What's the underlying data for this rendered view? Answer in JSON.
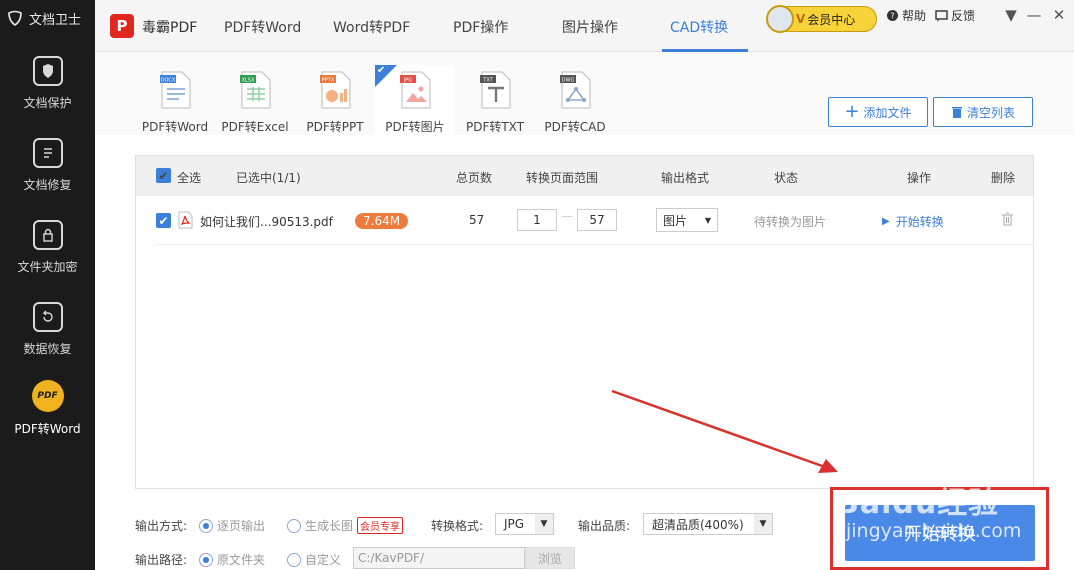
{
  "sidebar": {
    "brand": "文档卫士",
    "items": [
      {
        "label": "文档保护"
      },
      {
        "label": "文档修复"
      },
      {
        "label": "文件夹加密"
      },
      {
        "label": "数据恢复"
      },
      {
        "label": "PDF转Word",
        "icon_text": "PDF"
      }
    ]
  },
  "topbar": {
    "app_logo": "P",
    "app_name": "毒霸PDF",
    "tabs": [
      "PDF转Word",
      "Word转PDF",
      "PDF操作",
      "图片操作",
      "CAD转换"
    ],
    "active_tab": "CAD转换",
    "vip_v": "V",
    "vip_label": "会员中心",
    "help": "帮助",
    "feedback": "反馈"
  },
  "format_tabs": [
    {
      "label": "PDF转Word",
      "badge": "DOCX",
      "color": "#3b7fd9"
    },
    {
      "label": "PDF转Excel",
      "badge": "XLSX",
      "color": "#2e9e4f"
    },
    {
      "label": "PDF转PPT",
      "badge": "PPTX",
      "color": "#e8793a"
    },
    {
      "label": "PDF转图片",
      "badge": "JPG",
      "color": "#e0504a"
    },
    {
      "label": "PDF转TXT",
      "badge": "TXT",
      "color": "#555555"
    },
    {
      "label": "PDF转CAD",
      "badge": "DWG",
      "color": "#555555"
    }
  ],
  "actions": {
    "add_file": "添加文件",
    "clear_list": "清空列表"
  },
  "list": {
    "headers": {
      "select_all": "全选",
      "selected": "已选中(1/1)",
      "total_pages": "总页数",
      "range": "转换页面范围",
      "output_format": "输出格式",
      "status": "状态",
      "operation": "操作",
      "delete": "删除"
    },
    "rows": [
      {
        "filename": "如何让我们...90513.pdf",
        "size": "7.64M",
        "pages": "57",
        "range_from": "1",
        "range_to": "57",
        "format": "图片",
        "status": "待转换为图片",
        "action": "开始转换"
      }
    ]
  },
  "settings": {
    "output_mode_label": "输出方式:",
    "mode_each": "逐页输出",
    "mode_long": "生成长图",
    "vip_tag": "会员专享",
    "convert_format_label": "转换格式:",
    "convert_format": "JPG",
    "quality_label": "输出品质:",
    "quality": "超清品质(400%)",
    "path_label": "输出路径:",
    "path_source": "原文件夹",
    "path_custom": "自定义",
    "path_value": "C:/KavPDF/",
    "browse": "浏览"
  },
  "start_button": "开始转换",
  "watermark": {
    "line1": "Baidu经验",
    "line2": "jingyan.baidu.com"
  },
  "colors": {
    "accent": "#3b7fd9",
    "vip_gold": "#f7d33a",
    "annotation_red": "#d9322e"
  }
}
